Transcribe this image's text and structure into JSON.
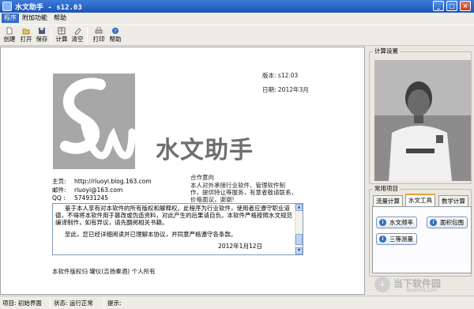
{
  "window": {
    "title": "水文助手 - s12.03"
  },
  "menu": [
    "程序",
    "附加功能",
    "帮助"
  ],
  "toolbar": [
    {
      "label": "创建",
      "icon": "new-file-icon"
    },
    {
      "label": "打开",
      "icon": "open-folder-icon"
    },
    {
      "label": "保存",
      "icon": "save-icon"
    },
    {
      "label": "计算",
      "icon": "calculate-icon"
    },
    {
      "label": "清空",
      "icon": "clear-icon"
    },
    {
      "label": "打印",
      "icon": "print-icon"
    },
    {
      "label": "帮助",
      "icon": "help-icon"
    }
  ],
  "about": {
    "logo_text": "水文助手",
    "version": "版本: s12.03",
    "date": "日期: 2012年3月",
    "homepage_label": "主页:",
    "homepage": "http://rluoyi.blog.163.com",
    "email_label": "邮件:",
    "email": "rluoyi@163.com",
    "qq_label": "QQ :",
    "qq": "574931245",
    "cooperation_title": "合作意向",
    "cooperation_lines": [
      "本人对外承接行业软件、管理软件制",
      "作，提供特让等服务，有意者敬请联系，",
      "价格面议，谢谢!"
    ],
    "agreement_p1": "鉴于本人享有对本软件的所有版权和解释权。此程序为行业软件，使用者应遵守职业道德，不得将本软件用于篡改或伪造资料，对此产生的后果请自负。本软件严格按照水文规范编译制作，如有异议，请先翻阅相关书籍。",
    "agreement_p2": "至此，您已经详细阅读并已理解本协议，并同意严格遵守各条款。",
    "agreement_sig": "2012年1月12日",
    "copyright": "本软件版权归 罐仪(吉扬秦酒) 个人所有"
  },
  "side": {
    "settings_label": "计算设置",
    "common_label": "常用项目",
    "tabs": [
      "流量计算",
      "水文工具",
      "数学计算"
    ],
    "active_tab": 1,
    "buttons": [
      "水文频率",
      "面积包围",
      "三等测量"
    ]
  },
  "watermark": {
    "name": "当下软件园",
    "url": "downxia.com"
  },
  "status": {
    "project_label": "项目:",
    "project_value": "初始界面",
    "state_label": "状态:",
    "state_value": "运行正常",
    "hint_label": "提示:"
  },
  "colors": {
    "titlebar": "#2459c2",
    "menu_active": "#316ac5",
    "tab_active_accent": "#e8a23a"
  }
}
